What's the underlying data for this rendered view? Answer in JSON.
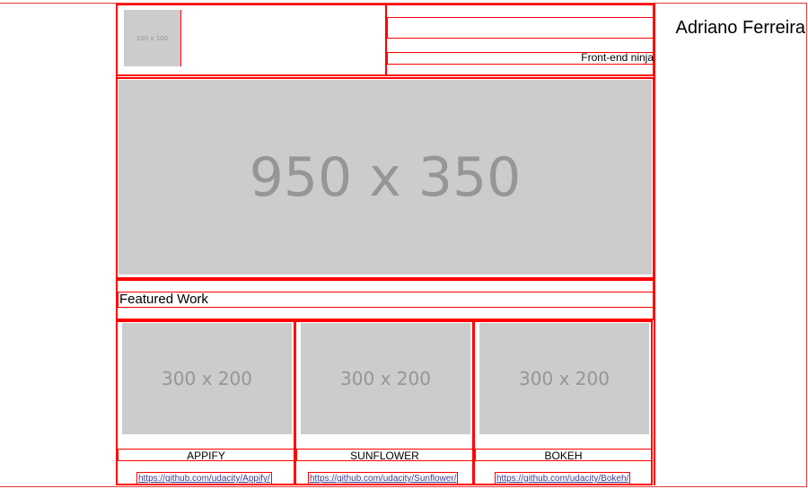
{
  "header": {
    "logo_text": "100 x 100",
    "name": "Adriano Ferreira",
    "subtitle": "Front-end ninja"
  },
  "hero": {
    "placeholder_text": "950 x 350"
  },
  "featured": {
    "title": "Featured Work",
    "items": [
      {
        "thumb_text": "300 x 200",
        "label": "APPIFY",
        "link": "https://github.com/udacity/Appify/"
      },
      {
        "thumb_text": "300 x 200",
        "label": "SUNFLOWER",
        "link": "https://github.com/udacity/Sunflower/"
      },
      {
        "thumb_text": "300 x 200",
        "label": "BOKEH",
        "link": "https://github.com/udacity/Bokeh/"
      }
    ]
  },
  "colors": {
    "outline": "#ff0000",
    "placeholder_bg": "#cccccc",
    "placeholder_text": "#969696",
    "link": "#3b3b8f"
  }
}
